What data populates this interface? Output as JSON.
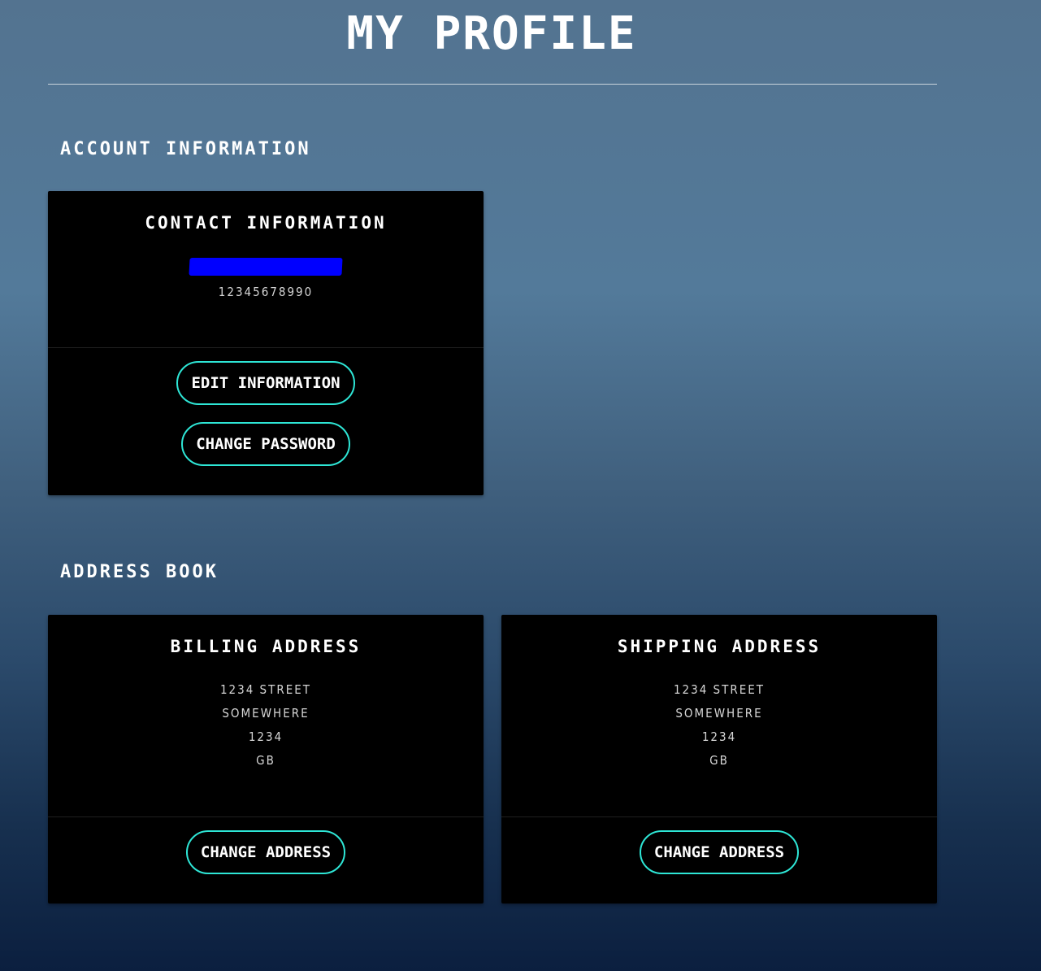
{
  "page": {
    "title": "MY PROFILE"
  },
  "account_section": {
    "heading": "ACCOUNT INFORMATION",
    "contact_card": {
      "title": "CONTACT INFORMATION",
      "phone": "12345678990",
      "edit_button": "EDIT INFORMATION",
      "password_button": "CHANGE PASSWORD"
    }
  },
  "address_section": {
    "heading": "ADDRESS BOOK",
    "billing": {
      "title": "BILLING ADDRESS",
      "street": "1234 STREET",
      "city": "SOMEWHERE",
      "postcode": "1234",
      "country": "GB",
      "button": "CHANGE ADDRESS"
    },
    "shipping": {
      "title": "SHIPPING ADDRESS",
      "street": "1234 STREET",
      "city": "SOMEWHERE",
      "postcode": "1234",
      "country": "GB",
      "button": "CHANGE ADDRESS"
    }
  },
  "colors": {
    "accent": "#2ee6d6",
    "card_bg": "#000000",
    "redaction": "#0000ff"
  }
}
